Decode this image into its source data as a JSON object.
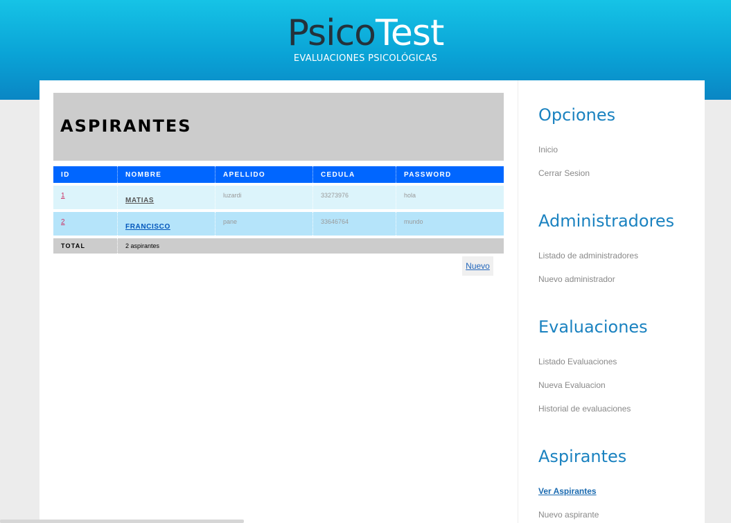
{
  "header": {
    "logo_dark": "Psico",
    "logo_light": "Test",
    "tagline": "EVALUACIONES PSICOLÓGICAS"
  },
  "page": {
    "title": "ASPIRANTES"
  },
  "table": {
    "columns": [
      "ID",
      "NOMBRE",
      "APELLIDO",
      "CEDULA",
      "PASSWORD"
    ],
    "rows": [
      {
        "id": "1",
        "nombre": "MATIAS",
        "apellido": "luzardi",
        "cedula": "33273976",
        "password": "hola"
      },
      {
        "id": "2",
        "nombre": "FRANCISCO",
        "apellido": "pane",
        "cedula": "33646764",
        "password": "mundo"
      }
    ],
    "total_label": "TOTAL",
    "total_value": "2 aspirantes"
  },
  "actions": {
    "nuevo_label": "Nuevo"
  },
  "sidebar": {
    "sections": [
      {
        "heading": "Opciones",
        "items": [
          "Inicio",
          "Cerrar Sesion"
        ]
      },
      {
        "heading": "Administradores",
        "items": [
          "Listado de administradores",
          "Nuevo administrador"
        ]
      },
      {
        "heading": "Evaluaciones",
        "items": [
          "Listado Evaluaciones",
          "Nueva Evaluacion",
          "Historial de evaluaciones"
        ]
      },
      {
        "heading": "Aspirantes",
        "items": [
          "Ver Aspirantes",
          "Nuevo aspirante"
        ]
      }
    ],
    "active_item": "Ver Aspirantes"
  },
  "colors": {
    "header_top": "#16c3e6",
    "header_bottom": "#0a86c4",
    "table_header": "#0066ff",
    "row_a": "#dcf4fb",
    "row_b": "#b5e4fa",
    "sidebar_heading": "#1a82c0"
  }
}
